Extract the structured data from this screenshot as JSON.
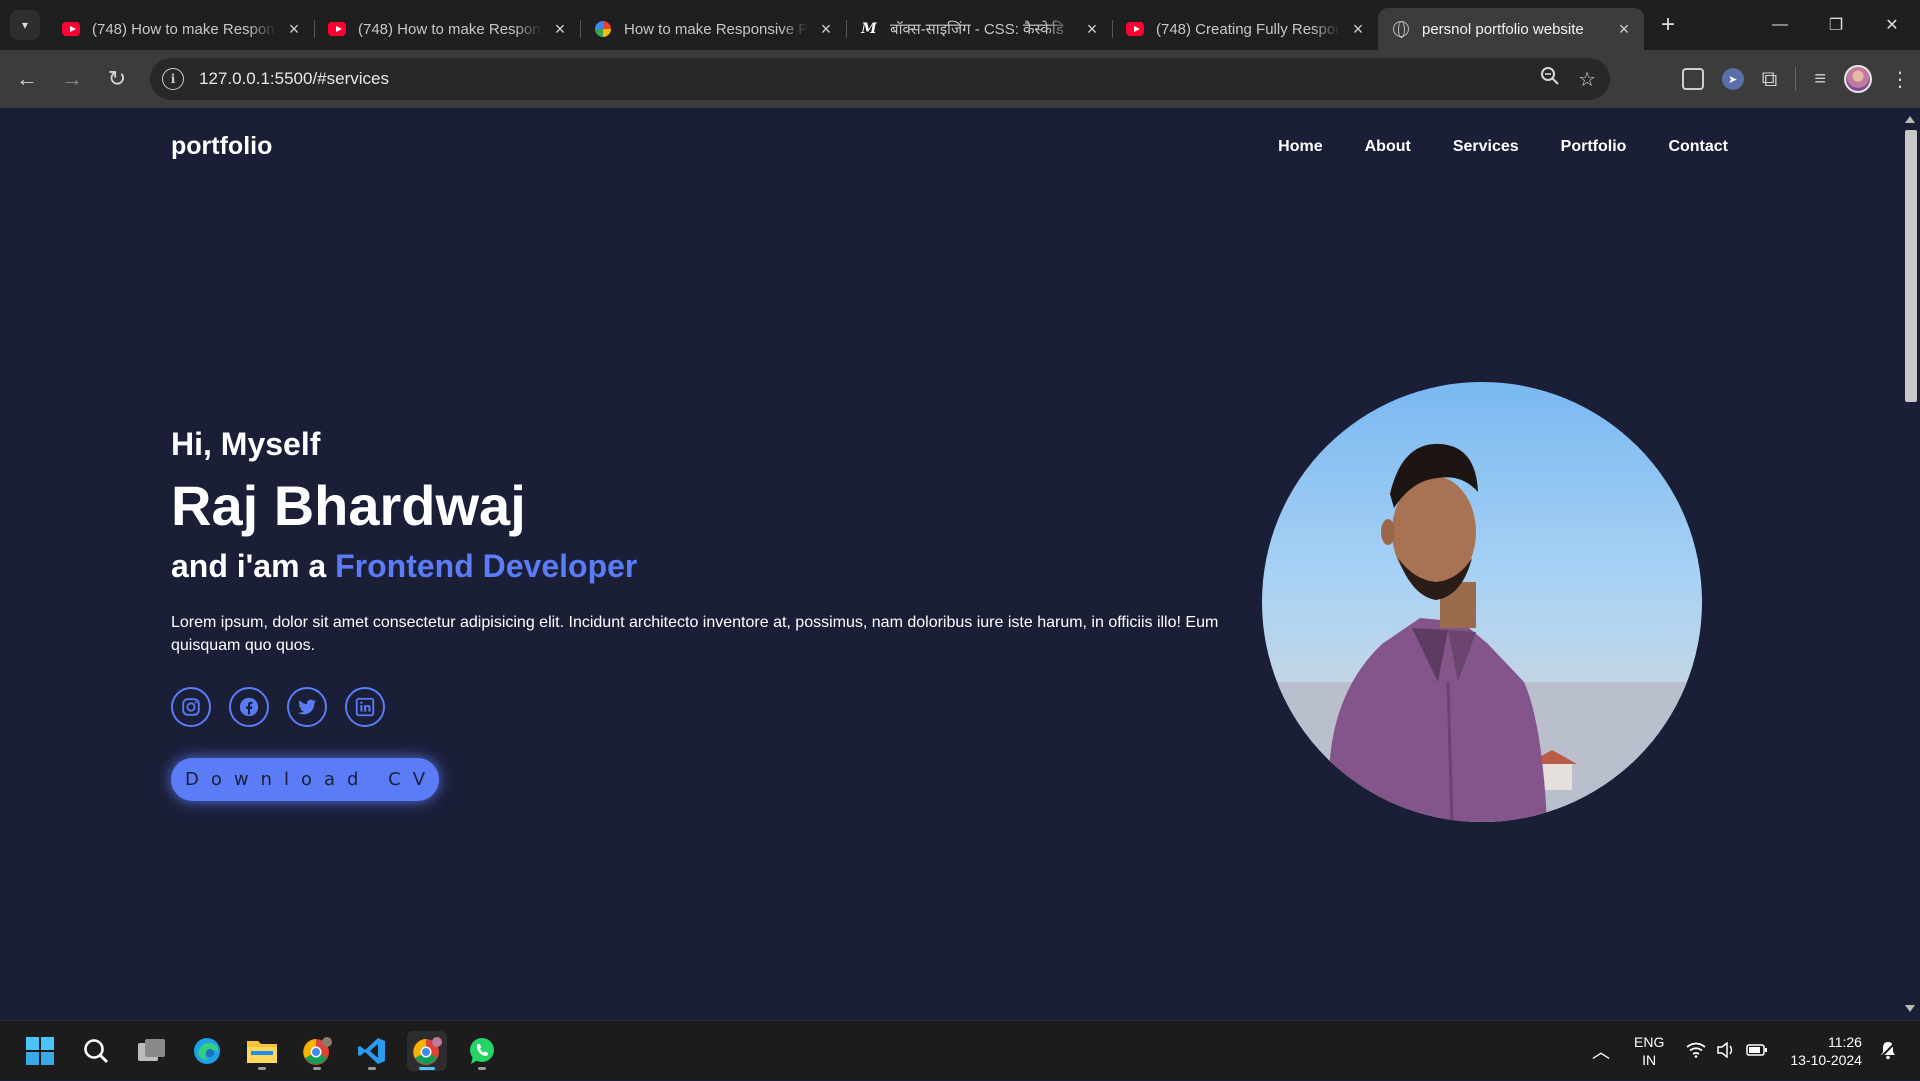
{
  "browser": {
    "tabs": [
      {
        "title": "(748) How to make Respon",
        "favicon": "youtube-icon"
      },
      {
        "title": "(748) How to make Respon",
        "favicon": "youtube-icon"
      },
      {
        "title": "How to make Responsive P",
        "favicon": "google-icon"
      },
      {
        "title": "बॉक्स-साइजिंग - CSS: कैस्केडि",
        "favicon": "mdn-icon"
      },
      {
        "title": "(748) Creating Fully Respon",
        "favicon": "youtube-icon"
      },
      {
        "title": "persnol portfolio website",
        "favicon": "globe-icon",
        "active": true
      }
    ],
    "url": "127.0.0.1:5500/#services"
  },
  "site": {
    "logo": "portfolio",
    "nav": [
      "Home",
      "About",
      "Services",
      "Portfolio",
      "Contact"
    ],
    "hero": {
      "greeting": "Hi, Myself",
      "name": "Raj Bhardwaj",
      "role_prefix": "and i'am a ",
      "role": "Frontend Developer",
      "description": "Lorem ipsum, dolor sit amet consectetur adipisicing elit. Incidunt architecto inventore at, possimus, nam doloribus iure iste harum, in officiis illo! Eum quisquam quo quos.",
      "cv_button": "Download CV"
    },
    "colors": {
      "background": "#1b1e37",
      "accent": "#5a7cf6",
      "text": "#ffffff"
    }
  },
  "taskbar": {
    "language": "ENG",
    "region": "IN",
    "time": "11:26",
    "date": "13-10-2024"
  }
}
